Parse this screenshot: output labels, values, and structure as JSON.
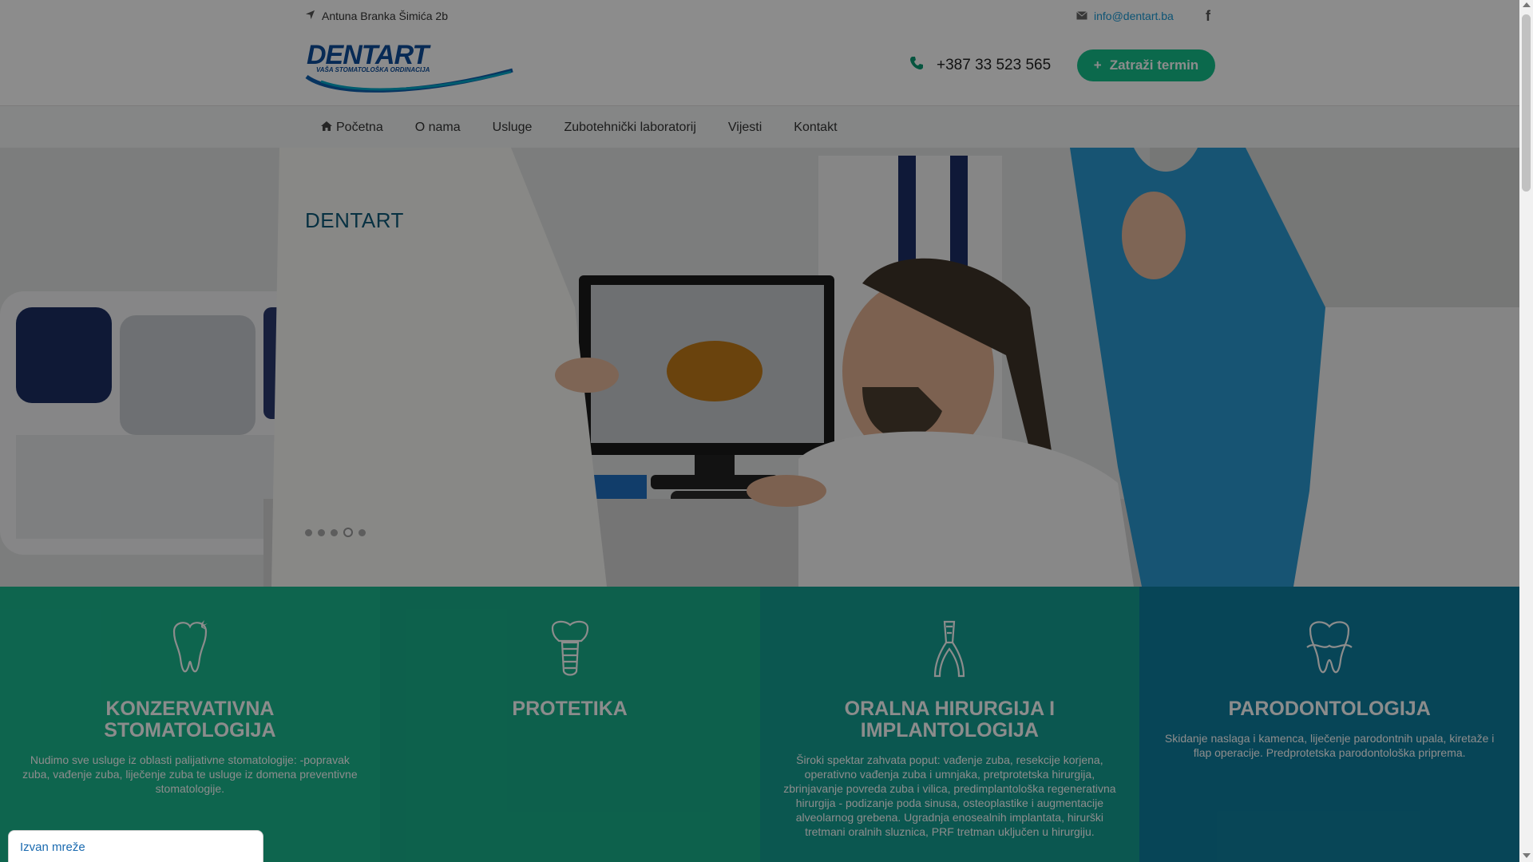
{
  "topbar": {
    "address": "Antuna Branka Šimića 2b",
    "email": "info@dentart.ba",
    "social_icon": "facebook-icon",
    "phone": "+387 33 523 565",
    "cta_label": "Zatraži termin",
    "logo": {
      "brand": "DENTART",
      "tagline": "VAŠA STOMATOLOŠKA ORDINACIJA"
    }
  },
  "nav": {
    "items": [
      {
        "label": "Početna",
        "icon": "home-icon"
      },
      {
        "label": "O nama"
      },
      {
        "label": "Usluge"
      },
      {
        "label": "Zubotehnički laboratorij"
      },
      {
        "label": "Vijesti"
      },
      {
        "label": "Kontakt"
      }
    ]
  },
  "hero": {
    "title": "DENTART",
    "slides_count": 5,
    "active_slide": 4
  },
  "services": [
    {
      "title": "KONZERVATIVNA STOMATOLOGIJA",
      "text": "Nudimo sve usluge iz oblasti palijativne stomatologije: -popravak zuba, vađenje zuba, liječenje zuba te usluge iz domena preventivne stomatologije.",
      "color": "#1ab88f",
      "icon": "tooth-sparkle-icon"
    },
    {
      "title": "PROTETIKA",
      "text": "",
      "color": "#18b08a",
      "icon": "dental-implant-icon"
    },
    {
      "title": "ORALNA HIRURGIJA I IMPLANTOLOGIJA",
      "text": "Široki spektar zahvata poput: vađenje zuba, resekcije korjena, operativno vađenja zuba i umnjaka, pretprotetska hirurgija, zbrinjavanje povreda zuba i vilica, predimplantološka regenerativna hirurgija - podizanje poda sinusa, osteoplastike i augmentacije alveolarnog grebena. Ugradnja enosealnih implantata, hirurški tretmani oralnih sluznica, PRF tretman uključen u hirurgiju.",
      "color": "#149f93",
      "icon": "dental-forceps-icon"
    },
    {
      "title": "PARODONTOLOGIJA",
      "text": "Skidanje naslaga i kamenca, liječenje parodontnih upala, kiretaže i flap operacije. Predprotetska parodontološka priprema.",
      "color": "#0e7f9e",
      "icon": "teeth-gums-icon"
    }
  ],
  "chat": {
    "status": "Izvan mreže"
  }
}
